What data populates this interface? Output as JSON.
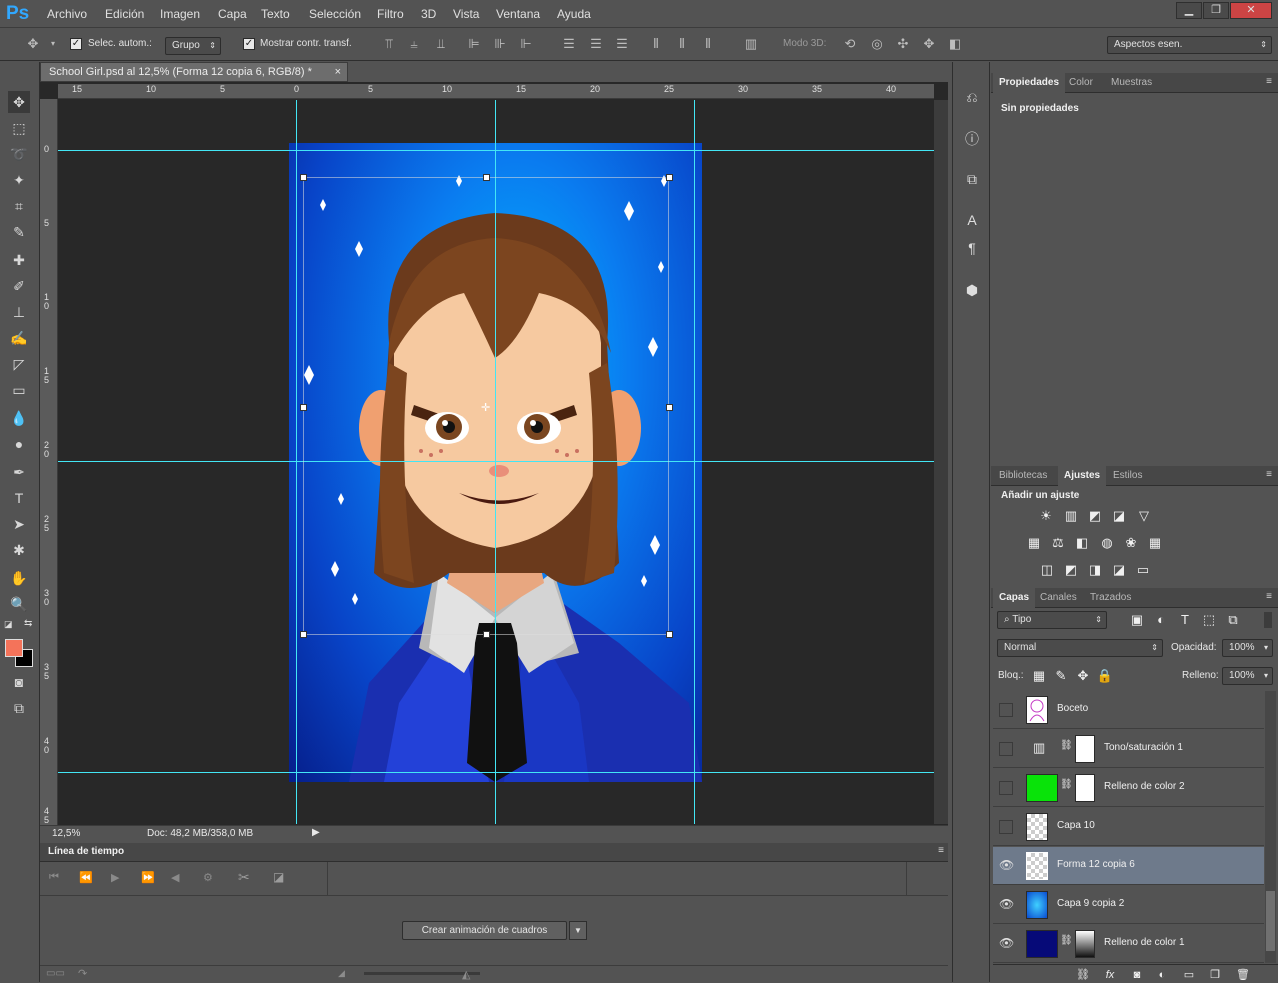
{
  "app": {
    "logo": "Ps"
  },
  "menu": [
    "Archivo",
    "Edición",
    "Imagen",
    "Capa",
    "Texto",
    "Selección",
    "Filtro",
    "3D",
    "Vista",
    "Ventana",
    "Ayuda"
  ],
  "window_controls": {
    "minimize": "▁",
    "restore": "❐",
    "close": "✕"
  },
  "options": {
    "auto_select_label": "Selec. autom.:",
    "auto_select_value": "Grupo",
    "show_transform_label": "Mostrar contr. transf.",
    "mode3d_label": "Modo 3D:",
    "workspace": "Aspectos esen."
  },
  "document": {
    "tab_title": "School Girl.psd al 12,5% (Forma 12 copia 6, RGB/8) *",
    "tab_close": "×",
    "zoom": "12,5%",
    "doc_size": "Doc: 48,2 MB/358,0 MB"
  },
  "ruler": {
    "top": [
      "15",
      "10",
      "5",
      "0",
      "5",
      "10",
      "15",
      "20",
      "25",
      "30",
      "35",
      "40"
    ],
    "left": [
      "0",
      "5",
      "1\n0",
      "1\n5",
      "2\n0",
      "2\n5",
      "3\n0",
      "3\n5",
      "4\n0",
      "4\n5"
    ]
  },
  "timeline": {
    "title": "Línea de tiempo",
    "create_button": "Crear animación de cuadros"
  },
  "properties": {
    "tabs": [
      "Propiedades",
      "Color",
      "Muestras"
    ],
    "active_tab": "Propiedades",
    "content": "Sin propiedades"
  },
  "adjustments": {
    "tabs": [
      "Bibliotecas",
      "Ajustes",
      "Estilos"
    ],
    "active_tab": "Ajustes",
    "heading": "Añadir un ajuste",
    "row1": [
      "☀",
      "▥",
      "◩",
      "◪",
      "▽"
    ],
    "row2": [
      "▦",
      "⚖",
      "◧",
      "◍",
      "❀",
      "▦"
    ],
    "row3": [
      "◫",
      "◩",
      "◨",
      "◪",
      "▭"
    ]
  },
  "layers_panel": {
    "tabs": [
      "Capas",
      "Canales",
      "Trazados"
    ],
    "active_tab": "Capas",
    "filter": "Tipo",
    "blend_mode": "Normal",
    "opacity_label": "Opacidad:",
    "opacity": "100%",
    "lock_label": "Bloq.:",
    "fill_label": "Relleno:",
    "fill": "100%",
    "layers": [
      {
        "name": "Boceto",
        "visible": false,
        "selected": false,
        "kind": "sketch"
      },
      {
        "name": "Tono/saturación 1",
        "visible": false,
        "selected": false,
        "kind": "adjust"
      },
      {
        "name": "Relleno de color 2",
        "visible": false,
        "selected": false,
        "kind": "green"
      },
      {
        "name": "Capa 10",
        "visible": false,
        "selected": false,
        "kind": "blank"
      },
      {
        "name": "Forma 12 copia 6",
        "visible": true,
        "selected": true,
        "kind": "checker"
      },
      {
        "name": "Capa 9 copia 2",
        "visible": true,
        "selected": false,
        "kind": "blue"
      },
      {
        "name": "Relleno de color 1",
        "visible": true,
        "selected": false,
        "kind": "navy"
      }
    ],
    "footer_icons": [
      "⛓",
      "fx",
      "◙",
      "◐",
      "▭",
      "❐",
      "🗑"
    ]
  },
  "colors": {
    "foreground": "#f4735a",
    "background": "#000000",
    "accent": "#31a8ff",
    "guide": "#43e6f5"
  }
}
